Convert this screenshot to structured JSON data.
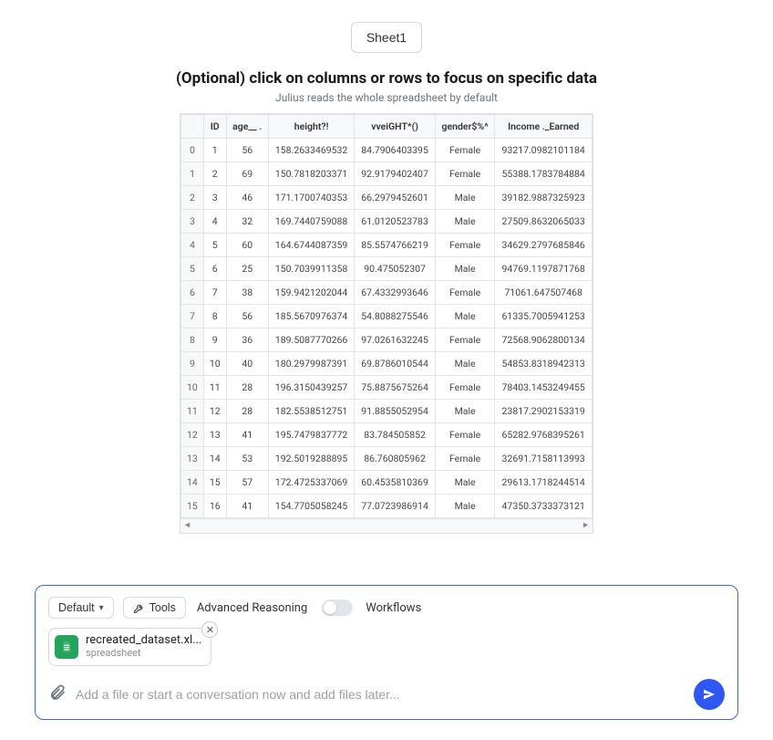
{
  "sheet_tab": "Sheet1",
  "heading": "(Optional) click on columns or rows to focus on specific data",
  "subheading": "Julius reads the whole spreadsheet by default",
  "columns": [
    "ID",
    "age__ .",
    "height?!",
    "vveiGHT*()",
    "gender$%^",
    "Income ._Earned"
  ],
  "rows": [
    {
      "idx": "0",
      "ID": "1",
      "age": "56",
      "height": "158.2633469532",
      "weight": "84.7906403395",
      "gender": "Female",
      "income": "93217.0982101184"
    },
    {
      "idx": "1",
      "ID": "2",
      "age": "69",
      "height": "150.7818203371",
      "weight": "92.9179402407",
      "gender": "Female",
      "income": "55388.1783784884"
    },
    {
      "idx": "2",
      "ID": "3",
      "age": "46",
      "height": "171.1700740353",
      "weight": "66.2979452601",
      "gender": "Male",
      "income": "39182.9887325923"
    },
    {
      "idx": "3",
      "ID": "4",
      "age": "32",
      "height": "169.7440759088",
      "weight": "61.0120523783",
      "gender": "Male",
      "income": "27509.8632065033"
    },
    {
      "idx": "4",
      "ID": "5",
      "age": "60",
      "height": "164.6744087359",
      "weight": "85.5574766219",
      "gender": "Female",
      "income": "34629.2797685846"
    },
    {
      "idx": "5",
      "ID": "6",
      "age": "25",
      "height": "150.7039911358",
      "weight": "90.475052307",
      "gender": "Male",
      "income": "94769.1197871768"
    },
    {
      "idx": "6",
      "ID": "7",
      "age": "38",
      "height": "159.9421202044",
      "weight": "67.4332993646",
      "gender": "Female",
      "income": "71061.647507468"
    },
    {
      "idx": "7",
      "ID": "8",
      "age": "56",
      "height": "185.5670976374",
      "weight": "54.8088275546",
      "gender": "Male",
      "income": "61335.7005941253"
    },
    {
      "idx": "8",
      "ID": "9",
      "age": "36",
      "height": "189.5087770266",
      "weight": "97.0261632245",
      "gender": "Female",
      "income": "72568.9062800134"
    },
    {
      "idx": "9",
      "ID": "10",
      "age": "40",
      "height": "180.2979987391",
      "weight": "69.8786010544",
      "gender": "Male",
      "income": "54853.8318942313"
    },
    {
      "idx": "10",
      "ID": "11",
      "age": "28",
      "height": "196.3150439257",
      "weight": "75.8875675264",
      "gender": "Female",
      "income": "78403.1453249455"
    },
    {
      "idx": "11",
      "ID": "12",
      "age": "28",
      "height": "182.5538512751",
      "weight": "91.8855052954",
      "gender": "Male",
      "income": "23817.2902153319"
    },
    {
      "idx": "12",
      "ID": "13",
      "age": "41",
      "height": "195.7479837772",
      "weight": "83.784505852",
      "gender": "Female",
      "income": "65282.9768395261"
    },
    {
      "idx": "13",
      "ID": "14",
      "age": "53",
      "height": "192.5019288895",
      "weight": "86.760805962",
      "gender": "Female",
      "income": "32691.7158113993"
    },
    {
      "idx": "14",
      "ID": "15",
      "age": "57",
      "height": "172.4725337069",
      "weight": "60.4535810369",
      "gender": "Male",
      "income": "29613.1718244514"
    },
    {
      "idx": "15",
      "ID": "16",
      "age": "41",
      "height": "154.7705058245",
      "weight": "77.0723986914",
      "gender": "Male",
      "income": "47350.3733373121"
    }
  ],
  "composer": {
    "default_label": "Default",
    "tools_label": "Tools",
    "advanced_label": "Advanced Reasoning",
    "workflows_label": "Workflows",
    "file_name": "recreated_dataset.xl...",
    "file_type": "spreadsheet",
    "placeholder": "Add a file or start a conversation now and add files later..."
  }
}
